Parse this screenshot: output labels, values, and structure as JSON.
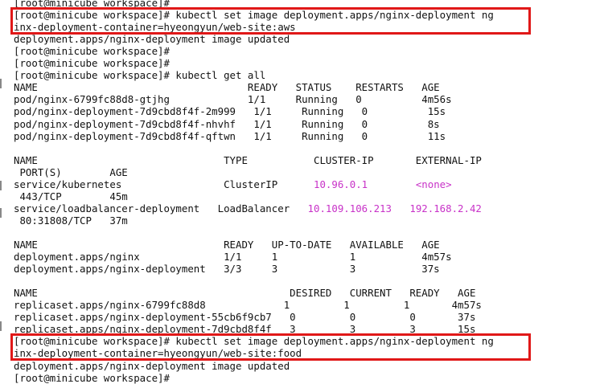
{
  "terminal": {
    "lines": [
      {
        "text": "[root@minicube workspace]#"
      },
      {
        "text": "[root@minicube workspace]# kubectl set image deployment.apps/nginx-deployment ng"
      },
      {
        "text": "inx-deployment-container=hyeongyun/web-site:aws"
      },
      {
        "text": "deployment.apps/nginx-deployment image updated"
      },
      {
        "text": "[root@minicube workspace]#"
      },
      {
        "text": "[root@minicube workspace]#"
      },
      {
        "text": "[root@minicube workspace]# kubectl get all"
      },
      {
        "text": "NAME                                   READY   STATUS    RESTARTS   AGE"
      },
      {
        "text": "pod/nginx-6799fc88d8-gtjhg             1/1     Running   0          4m56s"
      },
      {
        "text": "pod/nginx-deployment-7d9cbd8f4f-2m999   1/1     Running   0          15s"
      },
      {
        "text": "pod/nginx-deployment-7d9cbd8f4f-nhvhf   1/1     Running   0          8s"
      },
      {
        "text": "pod/nginx-deployment-7d9cbd8f4f-qftwn   1/1     Running   0          11s"
      },
      {
        "text": ""
      },
      {
        "text": "NAME                               TYPE           CLUSTER-IP       EXTERNAL-IP"
      },
      {
        "text": " PORT(S)        AGE"
      },
      {
        "segs": [
          {
            "t": "service/kubernetes                 ClusterIP      "
          },
          {
            "t": "10.96.0.1",
            "c": "mag"
          },
          {
            "t": "        "
          },
          {
            "t": "<none>",
            "c": "mag"
          }
        ]
      },
      {
        "text": " 443/TCP        45m"
      },
      {
        "segs": [
          {
            "t": "service/loadbalancer-deployment   LoadBalancer   "
          },
          {
            "t": "10.109.106.213",
            "c": "mag"
          },
          {
            "t": "   "
          },
          {
            "t": "192.168.2.42",
            "c": "mag"
          }
        ]
      },
      {
        "text": " 80:31808/TCP   37m"
      },
      {
        "text": ""
      },
      {
        "text": "NAME                               READY   UP-TO-DATE   AVAILABLE   AGE"
      },
      {
        "text": "deployment.apps/nginx              1/1     1            1           4m57s"
      },
      {
        "text": "deployment.apps/nginx-deployment   3/3     3            3           37s"
      },
      {
        "text": ""
      },
      {
        "text": "NAME                                          DESIRED   CURRENT   READY   AGE"
      },
      {
        "text": "replicaset.apps/nginx-6799fc88d8             1         1         1       4m57s"
      },
      {
        "text": "replicaset.apps/nginx-deployment-55cb6f9cb7   0         0         0       37s"
      },
      {
        "text": "replicaset.apps/nginx-deployment-7d9cbd8f4f   3         3         3       15s"
      },
      {
        "text": "[root@minicube workspace]# kubectl set image deployment.apps/nginx-deployment ng"
      },
      {
        "text": "inx-deployment-container=hyeongyun/web-site:food"
      },
      {
        "text": "deployment.apps/nginx-deployment image updated"
      },
      {
        "text": "[root@minicube workspace]#"
      }
    ],
    "highlighted_commands": [
      {
        "first_line": 1,
        "last_line": 2
      },
      {
        "first_line": 28,
        "last_line": 29
      }
    ],
    "colors": {
      "text": "#111111",
      "background": "#ffffff",
      "highlight_value": "#c832c8",
      "annotation_box": "#e01818"
    }
  }
}
